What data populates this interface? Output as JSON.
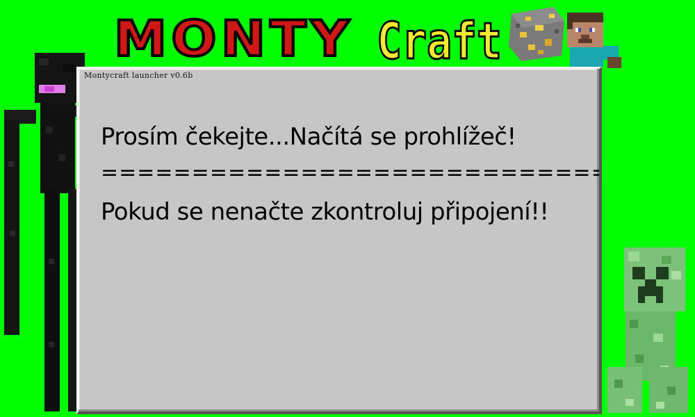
{
  "logo": {
    "brand_left": "MONTY",
    "brand_right": "Craft"
  },
  "window": {
    "title": "Montycraft launcher v0.6b"
  },
  "messages": {
    "loading": "Prosím čekejte...Načítá se prohlížeč!",
    "separator": "==========================================",
    "connection_hint": "Pokud se nenačte zkontroluj připojení!!"
  },
  "colors": {
    "background": "#00ff00",
    "panel": "#c6c6c6",
    "logo_red": "#e01e1e",
    "logo_yellow": "#f2ec3a"
  },
  "icons": [
    "enderman-icon",
    "gold-ore-block-icon",
    "steve-icon",
    "creeper-icon"
  ]
}
